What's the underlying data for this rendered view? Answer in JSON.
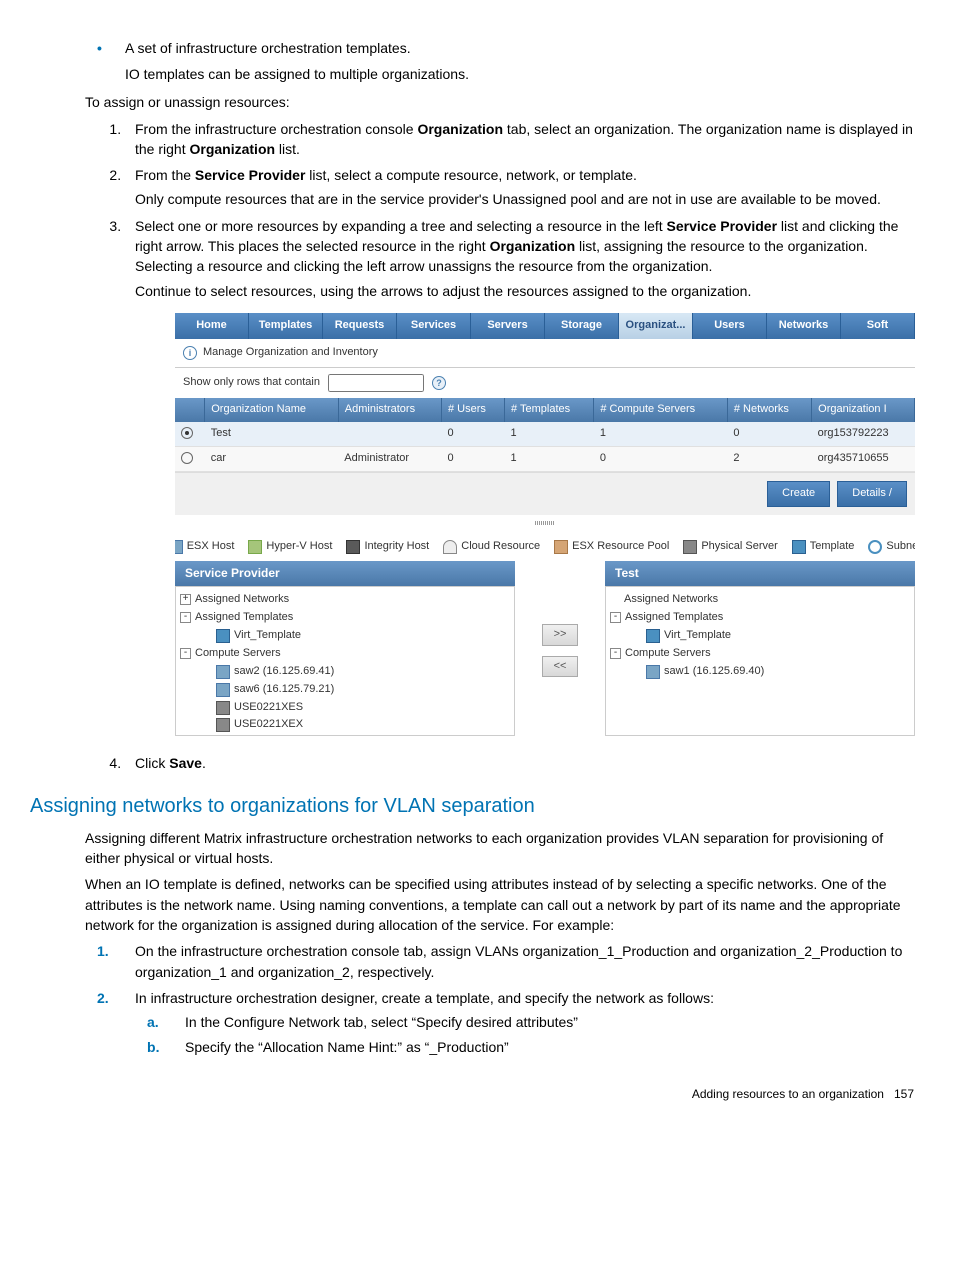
{
  "bullets": [
    "A set of infrastructure orchestration templates."
  ],
  "bullet_sub": "IO templates can be assigned to multiple organizations.",
  "intro": "To assign or unassign resources:",
  "steps": {
    "s1a": "From the infrastructure orchestration console ",
    "s1b": "Organization",
    "s1c": " tab, select an organization. The organization name is displayed in the right ",
    "s1d": "Organization",
    "s1e": " list.",
    "s2a": "From the ",
    "s2b": "Service Provider",
    "s2c": " list, select a compute resource, network, or template.",
    "s2p": "Only compute resources that are in the service provider's Unassigned pool and are not in use are available to be moved.",
    "s3a": "Select one or more resources by expanding a tree and selecting a resource in the left ",
    "s3b": "Service Provider",
    "s3c": " list and clicking the right arrow. This places the selected resource in the right ",
    "s3d": "Organization",
    "s3e": " list, assigning the resource to the organization. Selecting a resource and clicking the left arrow unassigns the resource from the organization.",
    "s3p": "Continue to select resources, using the arrows to adjust the resources assigned to the organization.",
    "s4a": "Click ",
    "s4b": "Save",
    "s4c": "."
  },
  "shot": {
    "tabs": [
      "Home",
      "Templates",
      "Requests",
      "Services",
      "Servers",
      "Storage",
      "Organizat...",
      "Users",
      "Networks",
      "Soft"
    ],
    "active_tab": 6,
    "subheader": "Manage Organization and Inventory",
    "filter_label": "Show only rows that contain",
    "columns": [
      "",
      "Organization Name",
      "Administrators",
      "# Users",
      "# Templates",
      "# Compute Servers",
      "# Networks",
      "Organization I"
    ],
    "rows": [
      {
        "sel": true,
        "name": "Test",
        "admin": "",
        "users": "0",
        "tmpl": "1",
        "comp": "1",
        "net": "0",
        "orgid": "org153792223"
      },
      {
        "sel": false,
        "name": "car",
        "admin": "Administrator",
        "users": "0",
        "tmpl": "1",
        "comp": "0",
        "net": "2",
        "orgid": "org435710655"
      }
    ],
    "buttons": {
      "create": "Create",
      "details": "Details /"
    },
    "legend": [
      {
        "icon": "ico-esx",
        "label": "ESX Host"
      },
      {
        "icon": "ico-hyperv",
        "label": "Hyper-V Host"
      },
      {
        "icon": "ico-integrity",
        "label": "Integrity Host"
      },
      {
        "icon": "ico-cloud",
        "label": "Cloud Resource"
      },
      {
        "icon": "ico-pool",
        "label": "ESX Resource Pool"
      },
      {
        "icon": "ico-phys",
        "label": "Physical Server"
      },
      {
        "icon": "ico-tmpl",
        "label": "Template"
      },
      {
        "icon": "ico-subnet",
        "label": "Subnet"
      }
    ],
    "left_panel": {
      "title": "Service Provider",
      "tree": [
        {
          "lvl": 0,
          "exp": "+",
          "icon": "",
          "label": "Assigned Networks"
        },
        {
          "lvl": 0,
          "exp": "-",
          "icon": "",
          "label": "Assigned Templates"
        },
        {
          "lvl": 2,
          "exp": "",
          "icon": "ico-tmpl",
          "label": "Virt_Template"
        },
        {
          "lvl": 0,
          "exp": "-",
          "icon": "",
          "label": "Compute Servers"
        },
        {
          "lvl": 2,
          "exp": "",
          "icon": "ico-esx",
          "label": "saw2 (16.125.69.41)"
        },
        {
          "lvl": 2,
          "exp": "",
          "icon": "ico-esx",
          "label": "saw6 (16.125.79.21)"
        },
        {
          "lvl": 2,
          "exp": "",
          "icon": "ico-phys",
          "label": "USE0221XES"
        },
        {
          "lvl": 2,
          "exp": "",
          "icon": "ico-phys",
          "label": "USE0221XEX"
        }
      ]
    },
    "right_panel": {
      "title": "Test",
      "tree": [
        {
          "lvl": 1,
          "exp": "",
          "icon": "",
          "label": "Assigned Networks"
        },
        {
          "lvl": 0,
          "exp": "-",
          "icon": "",
          "label": "Assigned Templates"
        },
        {
          "lvl": 2,
          "exp": "",
          "icon": "ico-tmpl",
          "label": "Virt_Template"
        },
        {
          "lvl": 0,
          "exp": "-",
          "icon": "",
          "label": "Compute Servers"
        },
        {
          "lvl": 2,
          "exp": "",
          "icon": "ico-esx",
          "label": "saw1 (16.125.69.40)"
        }
      ]
    },
    "move_right": ">>",
    "move_left": "<<"
  },
  "h2": "Assigning networks to organizations for VLAN separation",
  "p1": "Assigning different Matrix infrastructure orchestration networks to each organization provides VLAN separation for provisioning of either physical or virtual hosts.",
  "p2": "When an IO template is defined, networks can be specified using attributes instead of by selecting a specific networks. One of the attributes is the network name. Using naming conventions, a template can call out a network by part of its name and the appropriate network for the organization is assigned during allocation of the service. For example:",
  "ex1": "On the infrastructure orchestration console tab, assign VLANs organization_1_Production and organization_2_Production to organization_1 and organization_2, respectively.",
  "ex2": "In infrastructure orchestration designer, create a template, and specify the network as follows:",
  "ex2a": "In the Configure Network tab, select “Specify desired attributes”",
  "ex2b": "Specify the “Allocation Name Hint:” as “_Production”",
  "footer_text": "Adding resources to an organization",
  "footer_page": "157"
}
